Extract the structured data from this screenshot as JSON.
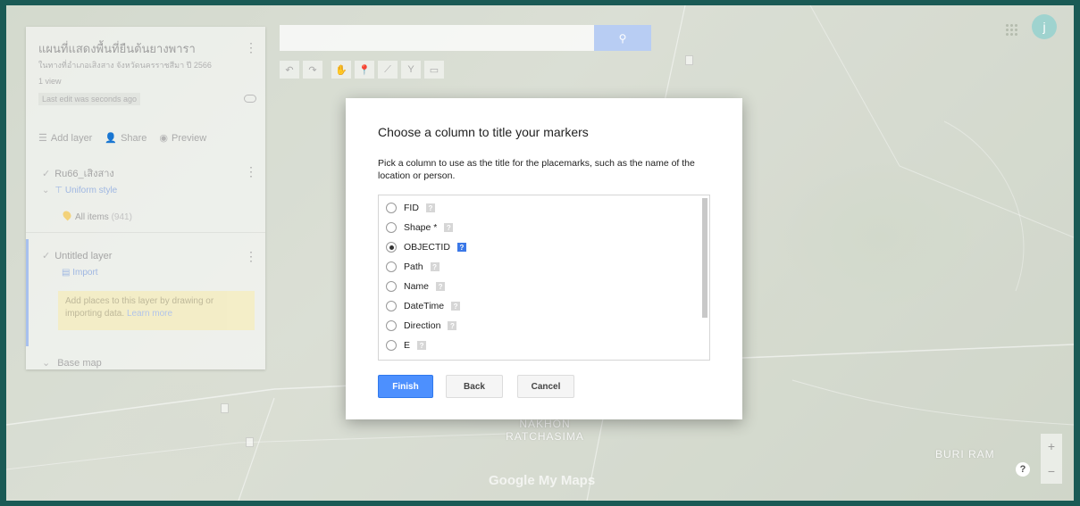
{
  "panel": {
    "map_title": "แผนที่แสดงพื้นที่ยืนต้นยางพารา",
    "map_description": "ในทางที่อำเภอเสิงสาง จังหวัดนครราชสีมา ปี 2566",
    "views": "1 view",
    "last_edit": "Last edit was seconds ago",
    "add_layer": "Add layer",
    "share": "Share",
    "preview": "Preview",
    "layer1_name": "Ru66_เสิงสาง",
    "uniform_style": "Uniform style",
    "all_items": "All items",
    "all_items_count": "(941)",
    "layer2_name": "Untitled layer",
    "import": "Import",
    "hint_text": "Add places to this layer by drawing or importing data.",
    "hint_link": "Learn more",
    "base_map": "Base map"
  },
  "search": {
    "placeholder": ""
  },
  "account": {
    "initial": "j"
  },
  "map_labels": {
    "city": "NAKHON RATCHASIMA",
    "buriram": "BURI RAM",
    "logo": "Google My Maps"
  },
  "dialog": {
    "title": "Choose a column to title your markers",
    "description": "Pick a column to use as the title for the placemarks, such as the name of the location or person.",
    "columns": [
      {
        "name": "FID",
        "selected": false
      },
      {
        "name": "Shape *",
        "selected": false
      },
      {
        "name": "OBJECTID",
        "selected": true
      },
      {
        "name": "Path",
        "selected": false
      },
      {
        "name": "Name",
        "selected": false
      },
      {
        "name": "DateTime",
        "selected": false
      },
      {
        "name": "Direction",
        "selected": false
      },
      {
        "name": "E",
        "selected": false
      }
    ],
    "finish_label": "Finish",
    "back_label": "Back",
    "cancel_label": "Cancel"
  },
  "colors": {
    "accent": "#4d90fe",
    "frame": "#1a5a55"
  }
}
